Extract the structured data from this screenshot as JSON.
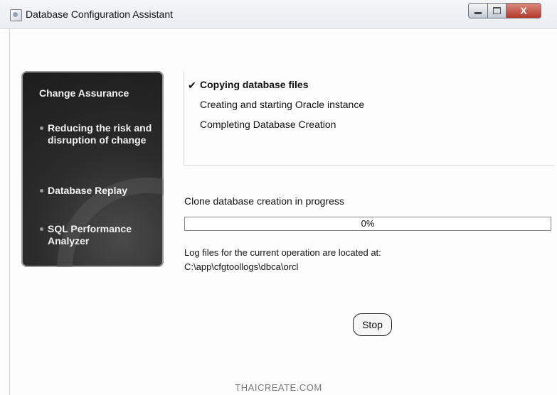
{
  "window": {
    "title": "Database Configuration Assistant",
    "close_glyph": "X",
    "icons": [
      "app-icon",
      "minimize-icon",
      "maximize-icon",
      "close-icon"
    ]
  },
  "side_panel": {
    "items": [
      "Change Assurance",
      "Reducing the risk and disruption of change",
      "Database Replay",
      "SQL Performance Analyzer"
    ]
  },
  "steps": {
    "check_glyph": "✔",
    "items": [
      "Copying database files",
      "Creating and starting Oracle instance",
      "Completing Database Creation"
    ],
    "current_index": 0
  },
  "progress": {
    "label": "Clone database creation in progress",
    "value_text": "0%",
    "value": 0
  },
  "log": {
    "label": "Log files for the current operation are located at:",
    "path": "C:\\app\\cfgtoollogs\\dbca\\orcl"
  },
  "buttons": {
    "stop_label": "Stop"
  },
  "watermark": {
    "text": "THAICREATE.COM"
  },
  "colors": {
    "progress_fill": "#3a7bd5",
    "panel_bg": "#2b2b2b",
    "close_button": "#c0463a"
  }
}
